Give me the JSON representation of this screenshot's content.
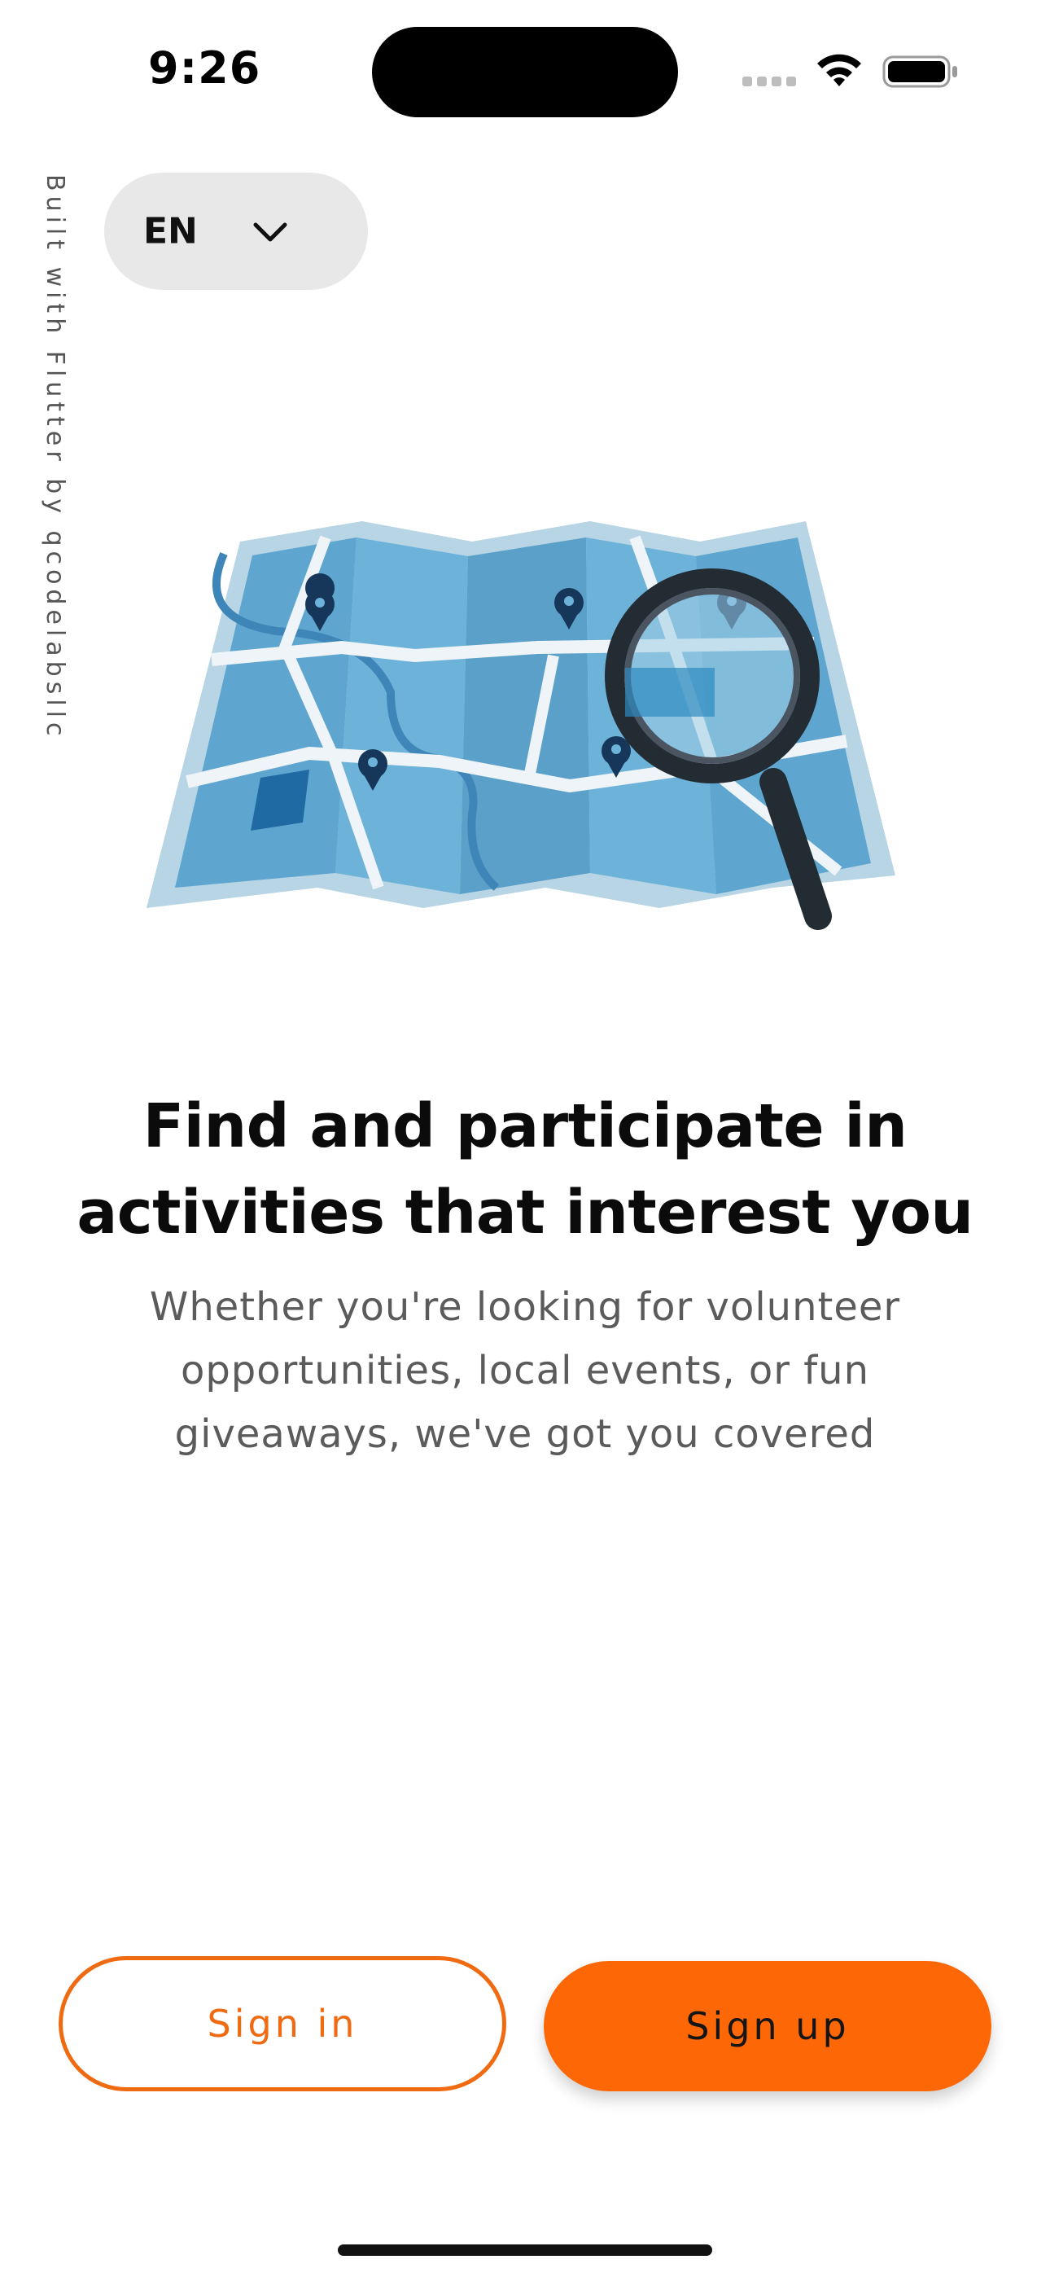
{
  "status_bar": {
    "time": "9:26"
  },
  "side_text": "Built with Flutter by qcodelabsllc",
  "language_selector": {
    "value": "EN",
    "icon": "chevron-down-icon"
  },
  "onboarding": {
    "illustration": "map-with-magnifier-illustration",
    "headline": "Find and participate in activities that interest you",
    "subtext": "Whether you're looking for volunteer opportunities, local events, or fun giveaways, we've got you covered"
  },
  "actions": {
    "signin_label": "Sign in",
    "signup_label": "Sign up"
  },
  "colors": {
    "accent": "#FD6706",
    "selector_bg": "#E8E8E8",
    "map_blue": "#5FA8D3"
  }
}
